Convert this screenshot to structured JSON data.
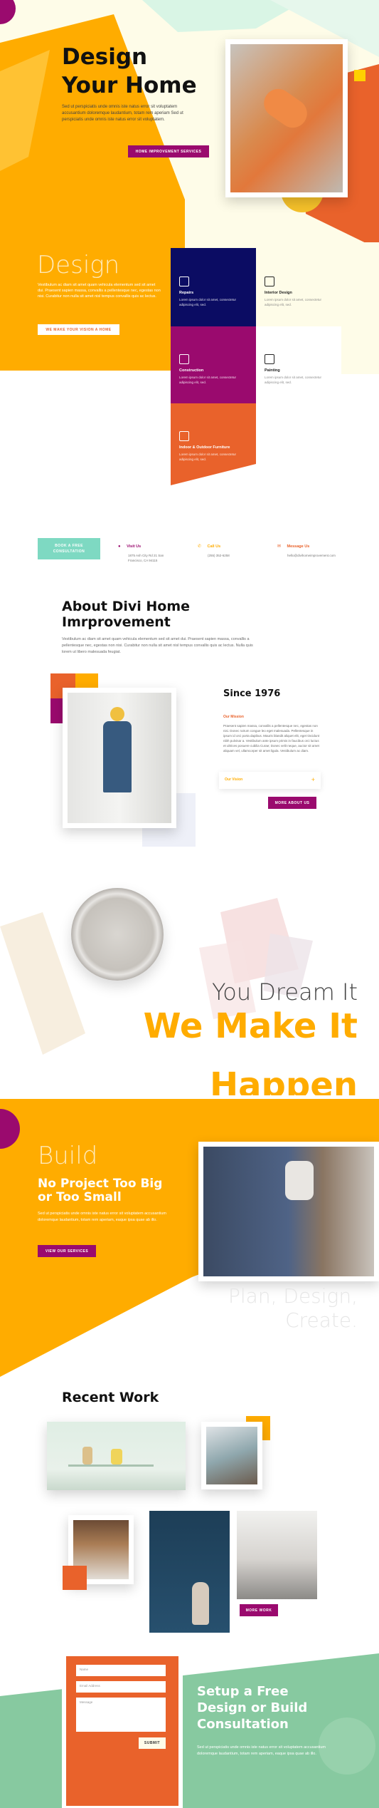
{
  "colors": {
    "orange": "#ffac00",
    "dark_orange": "#e9622b",
    "navy": "#0b0c63",
    "magenta": "#9a0a6e",
    "mint": "#7ed9c2",
    "cream": "#fefce8",
    "green": "#87c9a0",
    "light_green": "#d9f5e5"
  },
  "hero": {
    "title_line1": "Design",
    "title_line2": "Your Home",
    "body": "Sed ut perspiciatis unde omnis iste natus error sit voluptatem accusantium doloremque laudantium, totam rem aperiam Sed ut perspiciatis unde omnis iste natus error sit voluptatem.",
    "button": "Home Improvement Services"
  },
  "design_section": {
    "title": "Design",
    "body": "Vestibulum ac diam sit amet quam vehicula elementum sed sit amet dui. Praesent sapien massa, convallis a pellentesque nec, egestas non nisi. Curabitur non nulla sit amet nisl tempus convallis quis ac lectus.",
    "button": "We Make Your Vision a Home"
  },
  "services": [
    {
      "title": "Repairs",
      "desc": "Lorem ipsum dolor sit amet, consectetur adipiscing elit, sed.",
      "icon": "tools-icon"
    },
    {
      "title": "Interior Design",
      "desc": "Lorem ipsum dolor sit amet, consectetur adipiscing elit, sed.",
      "icon": "blocks-icon"
    },
    {
      "title": "Construction",
      "desc": "Lorem ipsum dolor sit amet, consectetur adipiscing elit, sed.",
      "icon": "bricks-icon"
    },
    {
      "title": "Painting",
      "desc": "Lorem ipsum dolor sit amet, consectetur adipiscing elit, sed.",
      "icon": "paint-roller-icon"
    },
    {
      "title": "Indoor & Outdoor Furniture",
      "desc": "Lorem ipsum dolor sit amet, consectetur adipiscing elit, sed.",
      "icon": "chair-icon"
    }
  ],
  "contact_bar": {
    "button": "Book a Free Consultation",
    "items": [
      {
        "label": "Visit Us",
        "value": "1875 Ash City Rd 21 San Francisco, CA 94115",
        "icon": "location-pin-icon"
      },
      {
        "label": "Call Us",
        "value": "(255) 352-6258",
        "icon": "phone-icon"
      },
      {
        "label": "Message Us",
        "value": "hello@divihomeimprovement.com",
        "icon": "mail-icon"
      }
    ]
  },
  "about": {
    "title_line1": "About Divi Home",
    "title_line2": "Imrprovement",
    "body": "Vestibulum ac diam sit amet quam vehicula elementum sed sit amet dui. Praesent sapien massa, convallis a pellentesque nec, egestas non nisi. Curabitur non nulla sit amet nisl tempus convallis quis ac lectus. Nulla quis lorem ut libero malesuada feugiat.",
    "since": "Since 1976",
    "mission_label": "Our Mission",
    "mission_text": "Praesent sapien massa, convallis a pellentesque nec, egestas non nisi. Donec rutrum congue leo eget malesuada. Pellentesque in ipsum id orci porta dapibus. Mauris blandit aliquet elit, eget tincidunt nibh pulvinar a. Vestibulum ante ipsum primis in faucibus orci luctus et ultrices posuere cubilia Curae; Donec velit neque, auctor sit amet aliquam vel, ullamcorper sit amet ligula. Vestibulum ac diam.",
    "vision_label": "Our Vision",
    "button": "More About Us"
  },
  "dream": {
    "line1": "You Dream It",
    "line2": "We Make It",
    "line3": "Happen"
  },
  "build": {
    "title": "Build",
    "subtitle_line1": "No Project Too Big",
    "subtitle_line2": "or Too Small",
    "body": "Sed ut perspiciatis unde omnis iste natus error sit voluptatem accusantium doloremque laudantium, totam rem aperiam, eaque ipsa quae ab illo.",
    "button": "View Our Services",
    "faded_line1": "Plan, Design,",
    "faded_line2": "Create."
  },
  "recent_work": {
    "title": "Recent Work",
    "button": "More Work"
  },
  "consult": {
    "fields": [
      "Name",
      "Email Address",
      "Message"
    ],
    "submit": "Submit",
    "title_line1": "Setup a Free",
    "title_line2": "Design or Build",
    "title_line3": "Consultation",
    "body": "Sed ut perspiciatis unde omnis iste natus error sit voluptatem accusantium doloremque laudantium, totam rem aperiam, eaque ipsa quae ab illo."
  }
}
